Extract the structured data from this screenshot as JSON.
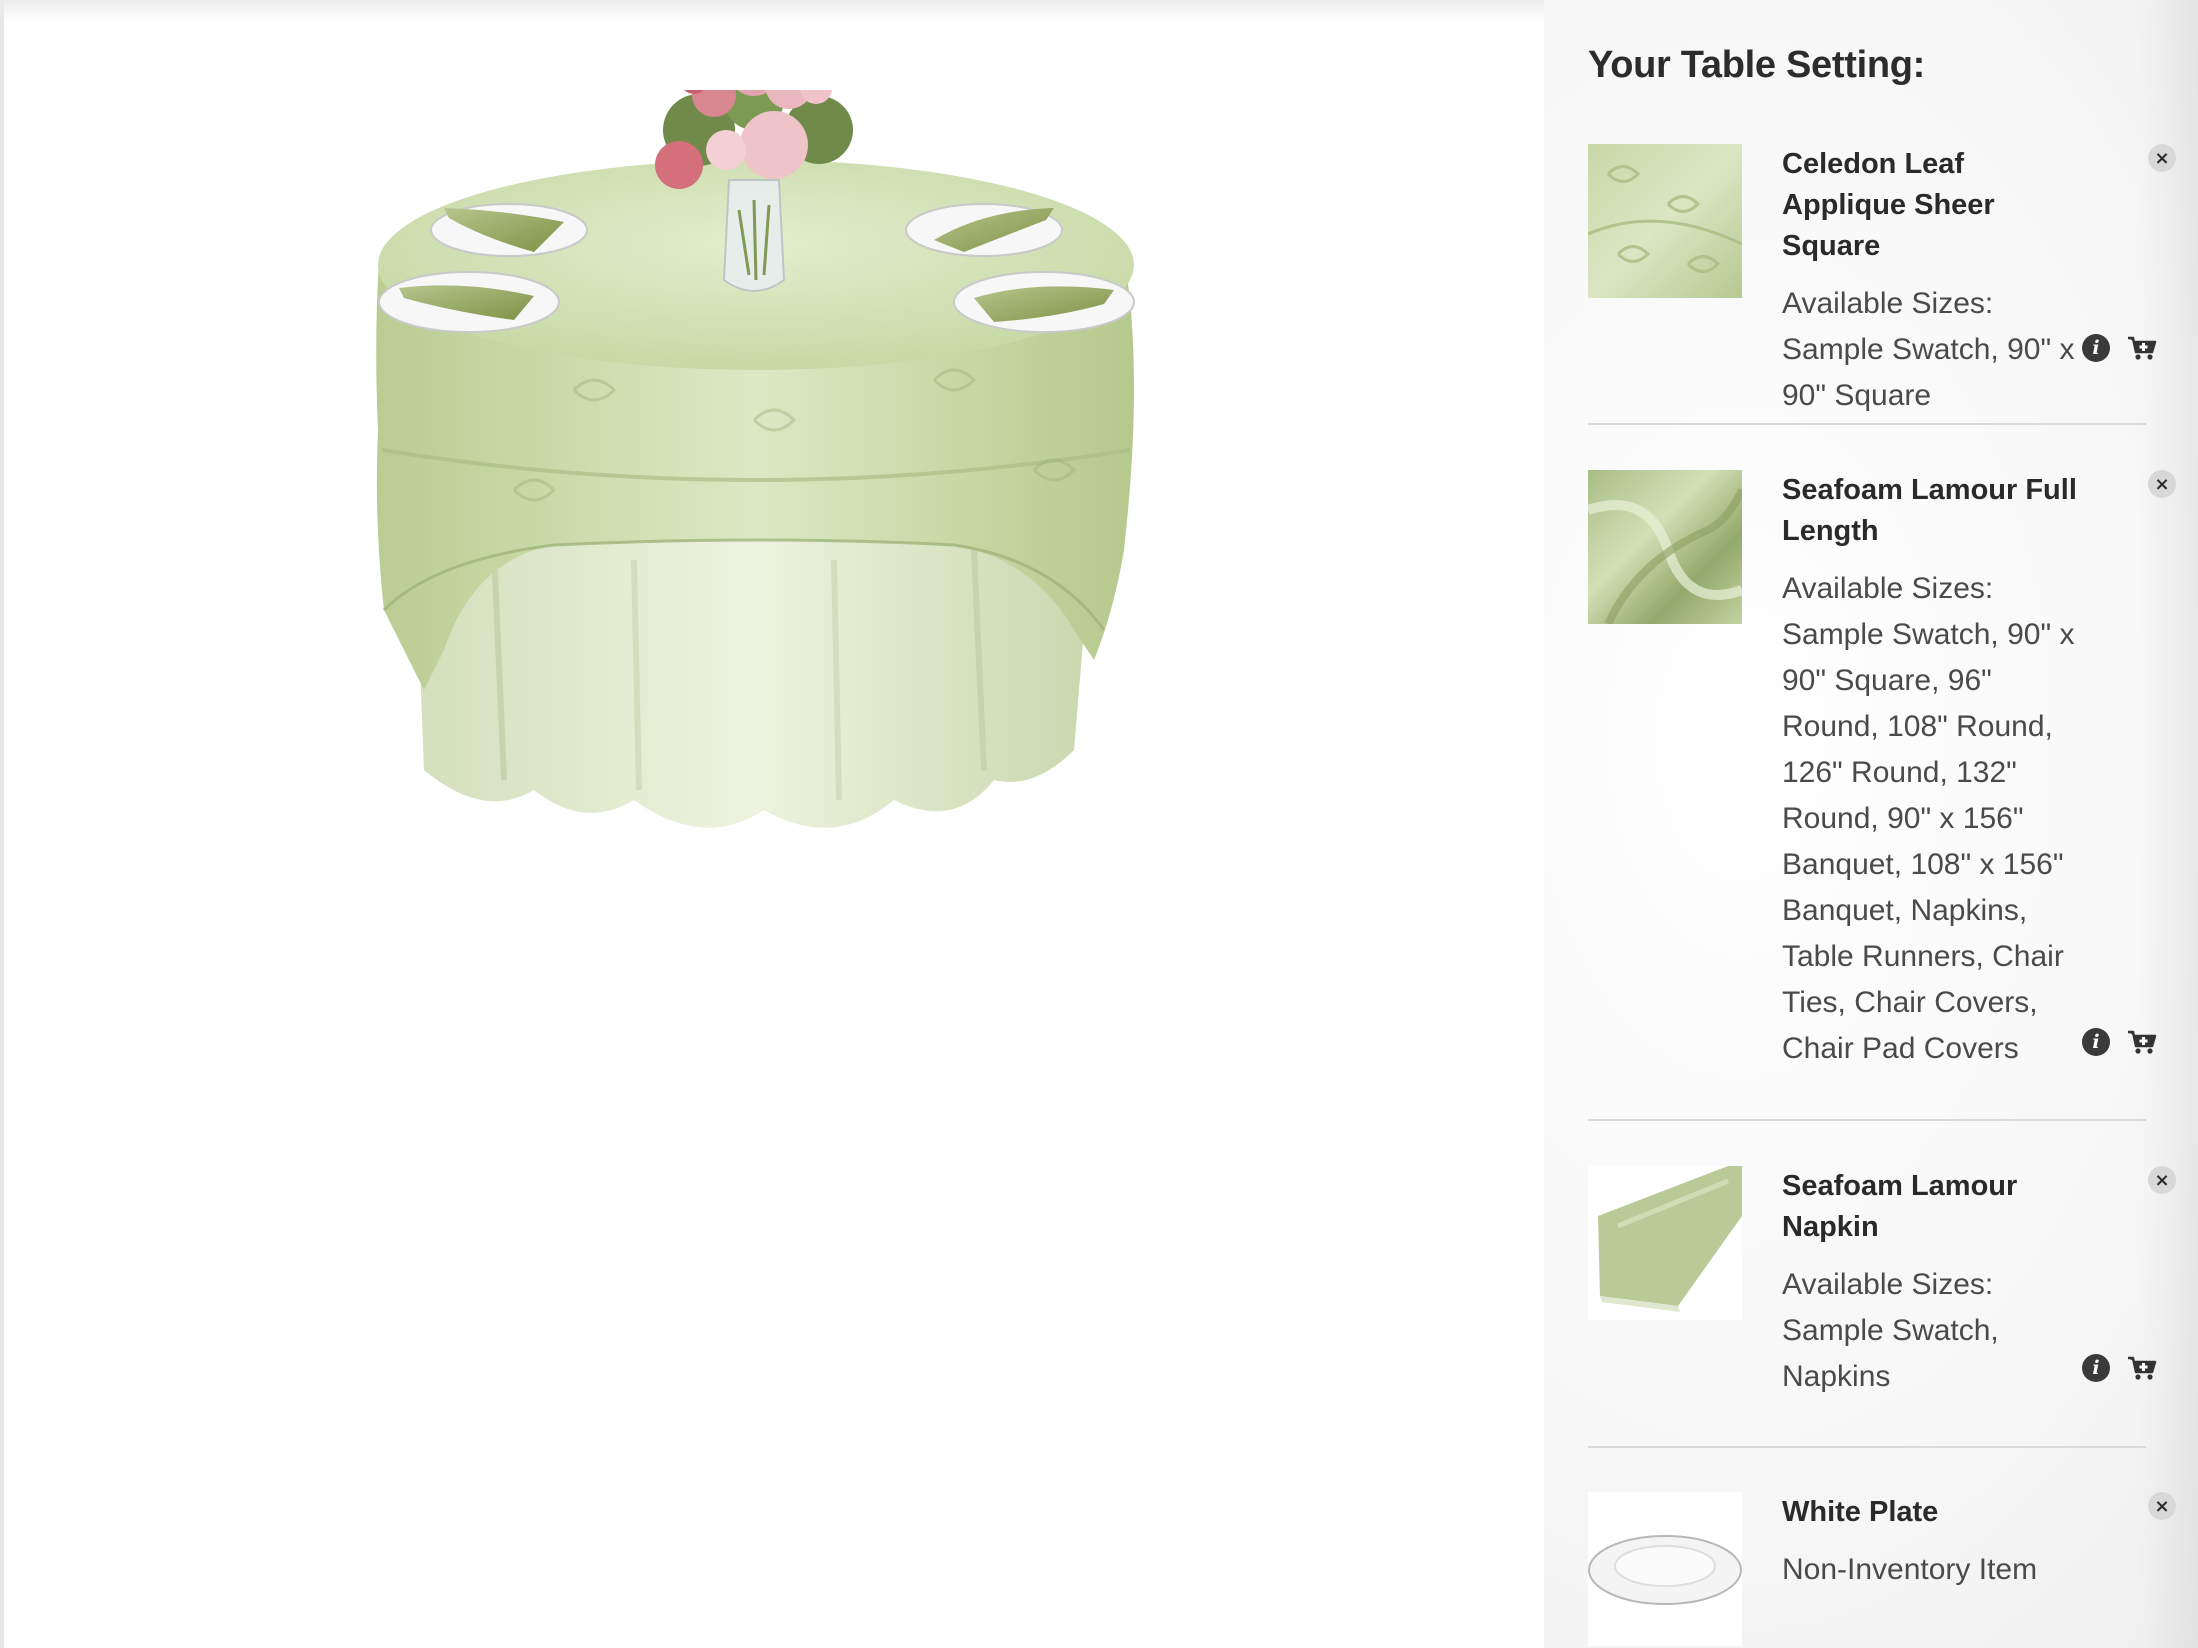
{
  "panel": {
    "title": "Your Table Setting:",
    "items": [
      {
        "name": "Celedon Leaf Applique Sheer Square",
        "sizes_label": "Available Sizes:",
        "sizes": "Sample Swatch, 90\" x 90\" Square",
        "thumb_icon": "sheer-fabric-swatch"
      },
      {
        "name": "Seafoam Lamour Full Length",
        "sizes_label": "Available Sizes:",
        "sizes": "Sample Swatch, 90\" x 90\" Square, 96\" Round, 108\" Round, 126\" Round, 132\" Round, 90\" x 156\" Banquet, 108\" x 156\" Banquet, Napkins, Table Runners, Chair Ties, Chair Covers, Chair Pad Covers",
        "thumb_icon": "satin-fabric-swatch"
      },
      {
        "name": "Seafoam Lamour Napkin",
        "sizes_label": "Available Sizes:",
        "sizes": "Sample Swatch, Napkins",
        "thumb_icon": "folded-napkin"
      },
      {
        "name": "White Plate",
        "note": "Non-Inventory Item",
        "thumb_icon": "white-plate"
      }
    ]
  },
  "icons": {
    "remove": "×",
    "info": "i",
    "cart": "cart-icon"
  },
  "colors": {
    "tablecloth": "#c9dcaa",
    "underlay": "#dfe8cc",
    "napkin": "#9fb06a",
    "panel_text": "#2c2c2c"
  }
}
